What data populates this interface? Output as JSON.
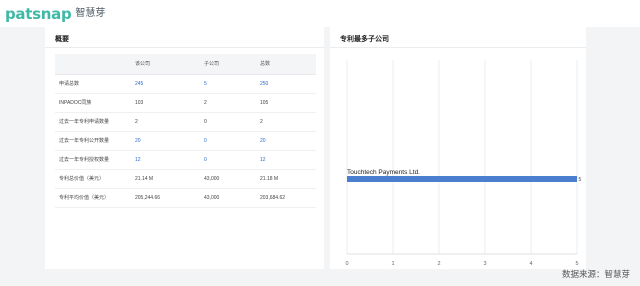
{
  "brand": {
    "word": "patsnap",
    "cn": "智慧芽"
  },
  "summary": {
    "title": "概要",
    "columns": [
      "",
      "该公司",
      "子公司",
      "总数"
    ],
    "rows": [
      {
        "label": "申请总数",
        "company": "245",
        "subsidiary": "5",
        "total": "250",
        "link": true
      },
      {
        "label": "INPADOC同族",
        "company": "103",
        "subsidiary": "2",
        "total": "105",
        "link": false
      },
      {
        "label": "过去一年专利申请数量",
        "company": "2",
        "subsidiary": "0",
        "total": "2",
        "link": false
      },
      {
        "label": "过去一年专利公开数量",
        "company": "20",
        "subsidiary": "0",
        "total": "20",
        "link": true
      },
      {
        "label": "过去一年专利授权数量",
        "company": "12",
        "subsidiary": "0",
        "total": "12",
        "link": true
      },
      {
        "label": "专利总价值（美元）",
        "company": "21.14 M",
        "subsidiary": "43,000",
        "total": "21.18 M",
        "link": false
      },
      {
        "label": "专利平均价值（美元）",
        "company": "205,244.66",
        "subsidiary": "43,000",
        "total": "203,684.62",
        "link": false
      }
    ]
  },
  "subsidiaries": {
    "title": "专利最多子公司"
  },
  "chart_data": {
    "type": "bar",
    "orientation": "horizontal",
    "categories": [
      "Touchtech Payments Ltd."
    ],
    "values": [
      5
    ],
    "data_labels": [
      "5"
    ],
    "xlim": [
      0,
      5
    ],
    "x_ticks": [
      "0",
      "1",
      "2",
      "3",
      "4",
      "5"
    ],
    "grid": true,
    "bar_color": "#4a7fcf"
  },
  "watermark": "数据来源：智慧芽"
}
